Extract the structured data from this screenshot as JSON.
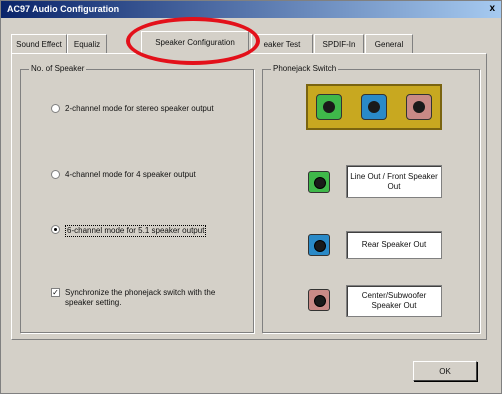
{
  "window": {
    "title": "AC97 Audio Configuration",
    "close_glyph": "x"
  },
  "tabs": [
    {
      "label": "Sound Effect",
      "active": false
    },
    {
      "label": "Equaliz",
      "active": false
    },
    {
      "label": "Speaker Configuration",
      "active": true
    },
    {
      "label": "eaker Test",
      "active": false
    },
    {
      "label": "SPDIF-In",
      "active": false
    },
    {
      "label": "General",
      "active": false
    }
  ],
  "speaker_group": {
    "title": "No. of Speaker",
    "options": [
      {
        "label": "2-channel mode for stereo speaker output",
        "selected": false
      },
      {
        "label": "4-channel mode for 4 speaker output",
        "selected": false
      },
      {
        "label": "6-channel mode for 5.1 speaker output",
        "selected": true
      }
    ],
    "sync_checkbox": {
      "label": "Synchronize the phonejack switch with the speaker setting.",
      "checked": true,
      "mark": "✓"
    }
  },
  "phonejack_group": {
    "title": "Phonejack Switch",
    "jack_colors": [
      "#3fb84a",
      "#2a8ac8",
      "#c98a86"
    ],
    "outputs": [
      {
        "label": "Line Out / Front Speaker Out",
        "color": "#3fb84a"
      },
      {
        "label": "Rear Speaker Out",
        "color": "#2a8ac8"
      },
      {
        "label": "Center/Subwoofer Speaker Out",
        "color": "#c98a86"
      }
    ]
  },
  "footer": {
    "ok_label": "OK"
  },
  "highlight": {
    "color": "#e3101a",
    "target": "Speaker Configuration tab"
  }
}
